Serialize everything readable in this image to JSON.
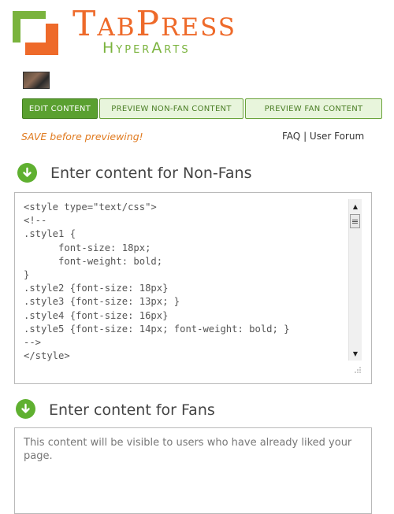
{
  "brand": {
    "title": "TabPress",
    "subtitle": "HyperArts",
    "colors": {
      "orange": "#ee6a2a",
      "green": "#7ab33d"
    }
  },
  "tabs": [
    {
      "label": "EDIT CONTENT",
      "active": true
    },
    {
      "label": "PREVIEW NON-FAN CONTENT",
      "active": false
    },
    {
      "label": "PREVIEW FAN CONTENT",
      "active": false
    }
  ],
  "notice": "SAVE before previewing!",
  "links": {
    "faq": "FAQ",
    "separator": " | ",
    "forum": "User Forum"
  },
  "non_fans": {
    "icon": "down-arrow-icon",
    "title": "Enter content for Non-Fans",
    "content": "<style type=\"text/css\">\n<!--\n.style1 {\n      font-size: 18px;\n      font-weight: bold;\n}\n.style2 {font-size: 18px}\n.style3 {font-size: 13px; }\n.style4 {font-size: 16px}\n.style5 {font-size: 14px; font-weight: bold; }\n-->\n</style>"
  },
  "fans": {
    "icon": "down-arrow-icon",
    "title": "Enter content for Fans",
    "content": "This content will be visible to users who have already liked your page."
  }
}
